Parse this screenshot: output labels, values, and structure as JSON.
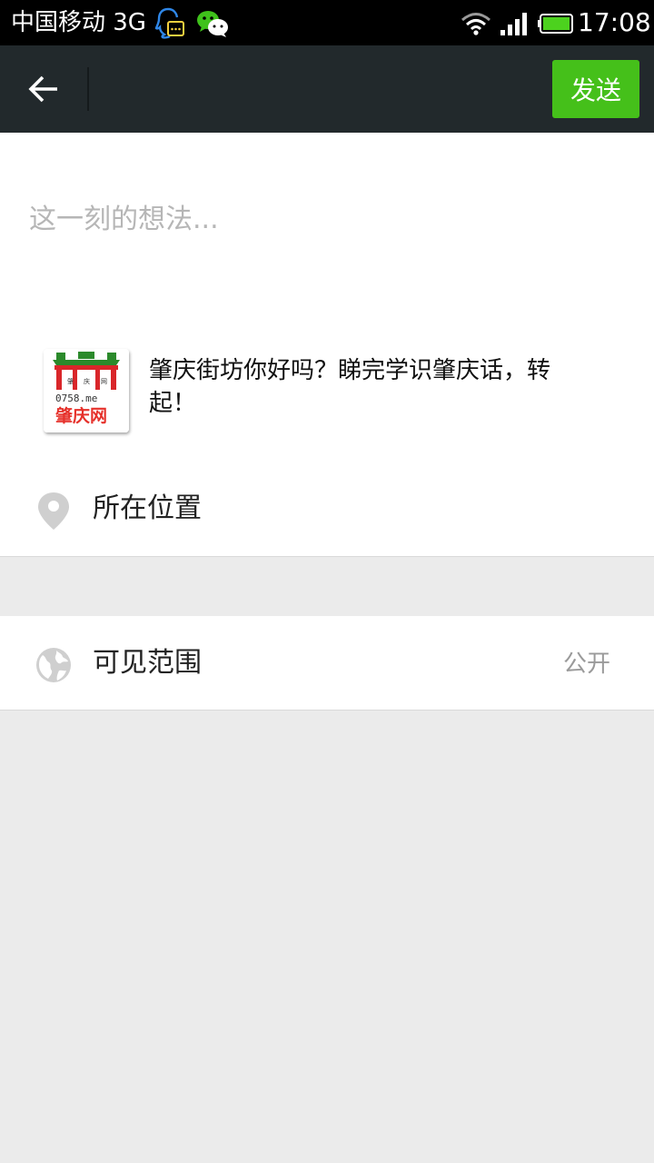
{
  "status_bar": {
    "carrier": "中国移动 3G",
    "time": "17:08",
    "icons": [
      "qq-notification-icon",
      "wechat-icon",
      "wifi-icon",
      "signal-icon",
      "battery-icon"
    ]
  },
  "toolbar": {
    "back_icon": "arrow-left-icon",
    "send_label": "发送"
  },
  "compose": {
    "placeholder": "这一刻的想法...",
    "value": ""
  },
  "link_card": {
    "title": "肇庆街坊你好吗？睇完学识肇庆话，转起！",
    "thumbnail": {
      "logo_text": "0758.me",
      "logo_name": "肇庆网"
    }
  },
  "location": {
    "icon": "location-pin-icon",
    "label": "所在位置"
  },
  "visibility": {
    "icon": "globe-icon",
    "label": "可见范围",
    "value": "公开"
  },
  "colors": {
    "toolbar_bg": "#22292c",
    "accent_green": "#45c01a",
    "page_bg": "#ebebeb",
    "placeholder": "#b6b6b6"
  }
}
